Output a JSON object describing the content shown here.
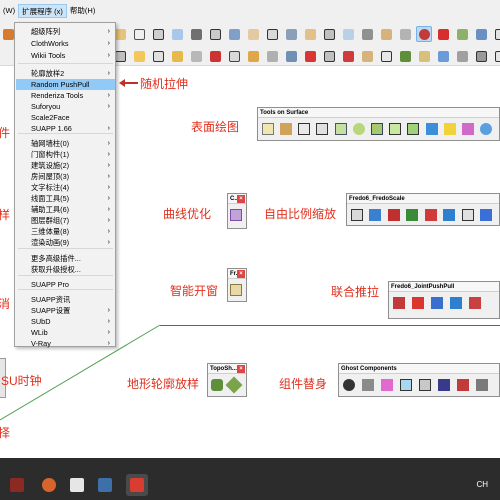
{
  "menubar": {
    "items": [
      {
        "label": "(W)",
        "active": false
      },
      {
        "label": "扩展程序 (x)",
        "active": true
      },
      {
        "label": "帮助(H)",
        "active": false
      }
    ]
  },
  "dropdown": {
    "items": [
      {
        "label": "超级阵列",
        "submenu": true
      },
      {
        "label": "ClothWorks",
        "submenu": true
      },
      {
        "label": "Wikii Tools",
        "submenu": true
      },
      {
        "label": "轮廓放样2",
        "submenu": true
      },
      {
        "label": "Random PushPull",
        "submenu": false,
        "selected": true
      },
      {
        "label": "Renderiza Tools",
        "submenu": true
      },
      {
        "label": "Suforyou",
        "submenu": true
      },
      {
        "label": "Scale2Face",
        "submenu": false
      },
      {
        "label": "SUAPP 1.66",
        "submenu": true
      },
      {
        "label": "轴网墙柱(0)",
        "submenu": true
      },
      {
        "label": "门窗构件(1)",
        "submenu": true
      },
      {
        "label": "建筑设施(2)",
        "submenu": true
      },
      {
        "label": "房间屋顶(3)",
        "submenu": true
      },
      {
        "label": "文字标注(4)",
        "submenu": true
      },
      {
        "label": "线面工具(5)",
        "submenu": true
      },
      {
        "label": "辅助工具(6)",
        "submenu": true
      },
      {
        "label": "图层群组(7)",
        "submenu": true
      },
      {
        "label": "三维体量(8)",
        "submenu": true
      },
      {
        "label": "渲染动画(9)",
        "submenu": true
      },
      {
        "label": "更多高级插件...",
        "submenu": false
      },
      {
        "label": "获取升级授权...",
        "submenu": false
      },
      {
        "label": "SUAPP Pro",
        "submenu": false
      },
      {
        "label": "SUAPP资讯",
        "submenu": false
      },
      {
        "label": "SUAPP设置",
        "submenu": true
      },
      {
        "label": "SUbD",
        "submenu": true
      },
      {
        "label": "WLib",
        "submenu": true
      },
      {
        "label": "V-Ray",
        "submenu": true
      }
    ]
  },
  "panels": {
    "tools_on_surface": {
      "title": "Tools on Surface"
    },
    "curve": {
      "title": "C..."
    },
    "fredo_scale": {
      "title": "Fredo6_FredoScale"
    },
    "window": {
      "title": "Fr..."
    },
    "joint_pushpull": {
      "title": "Fredo6_JointPushPull"
    },
    "toposhaper": {
      "title": "TopoSh..."
    },
    "ghost_components": {
      "title": "Ghost Components"
    }
  },
  "annotations": {
    "random_pushpull": "随机拉伸",
    "surface_draw": "表面绘图",
    "curve_optimize": "曲线优化",
    "free_scale": "自由比例缩放",
    "smart_window": "智能开窗",
    "joint_pushpull": "联合推拉",
    "terrain_loft": "地形轮廓放样",
    "component_replace": "组件替身",
    "su_clock": "SU时钟",
    "left_1": "件",
    "left_2": "样",
    "left_3": "消",
    "left_4": "择"
  },
  "taskbar": {
    "tray_text": "CH"
  },
  "colors": {
    "annotation": "#e0301e",
    "menu_highlight": "#91c9f7",
    "axis_red": "#c23a3a",
    "axis_green": "#54a054",
    "axis_blue": "#3d64c7",
    "taskbar": "#2c2c2c"
  }
}
